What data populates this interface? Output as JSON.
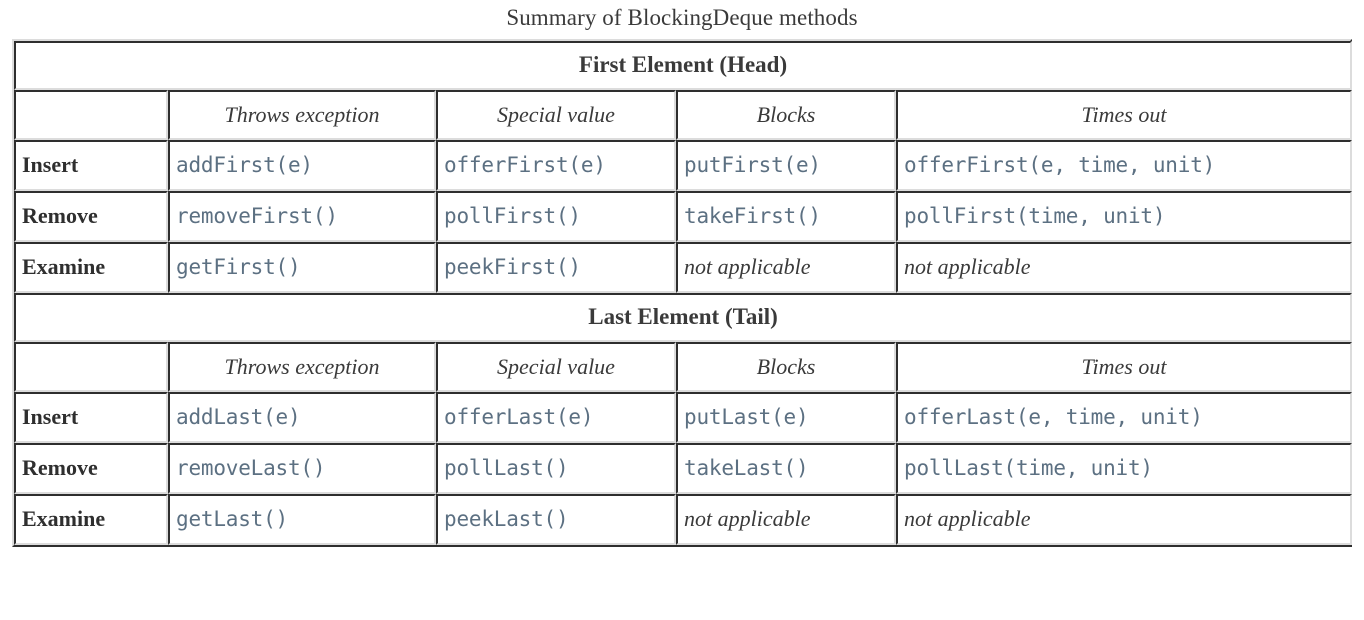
{
  "caption": "Summary of BlockingDeque methods",
  "colors": {
    "code_text": "#5c7082",
    "heading_text": "#3a3a3a",
    "border_dark": "#2e2e2e",
    "border_light": "#dcdcdc",
    "background": "#ffffff"
  },
  "table": {
    "column_headers": {
      "blank": "",
      "throws": "Throws exception",
      "special": "Special value",
      "blocks": "Blocks",
      "times_out": "Times out"
    },
    "sections": [
      {
        "heading": "First Element (Head)",
        "headers": [
          "",
          "Throws exception",
          "Special value",
          "Blocks",
          "Times out"
        ],
        "rows": [
          {
            "label": "Insert",
            "throws": "addFirst(e)",
            "special": "offerFirst(e)",
            "blocks": "putFirst(e)",
            "times_out": "offerFirst(e, time, unit)",
            "blocks_na": false,
            "times_out_na": false
          },
          {
            "label": "Remove",
            "throws": "removeFirst()",
            "special": "pollFirst()",
            "blocks": "takeFirst()",
            "times_out": "pollFirst(time, unit)",
            "blocks_na": false,
            "times_out_na": false
          },
          {
            "label": "Examine",
            "throws": "getFirst()",
            "special": "peekFirst()",
            "blocks": "not applicable",
            "times_out": "not applicable",
            "blocks_na": true,
            "times_out_na": true
          }
        ]
      },
      {
        "heading": "Last Element (Tail)",
        "headers": [
          "",
          "Throws exception",
          "Special value",
          "Blocks",
          "Times out"
        ],
        "rows": [
          {
            "label": "Insert",
            "throws": "addLast(e)",
            "special": "offerLast(e)",
            "blocks": "putLast(e)",
            "times_out": "offerLast(e, time, unit)",
            "blocks_na": false,
            "times_out_na": false
          },
          {
            "label": "Remove",
            "throws": "removeLast()",
            "special": "pollLast()",
            "blocks": "takeLast()",
            "times_out": "pollLast(time, unit)",
            "blocks_na": false,
            "times_out_na": false
          },
          {
            "label": "Examine",
            "throws": "getLast()",
            "special": "peekLast()",
            "blocks": "not applicable",
            "times_out": "not applicable",
            "blocks_na": true,
            "times_out_na": true
          }
        ]
      }
    ]
  }
}
